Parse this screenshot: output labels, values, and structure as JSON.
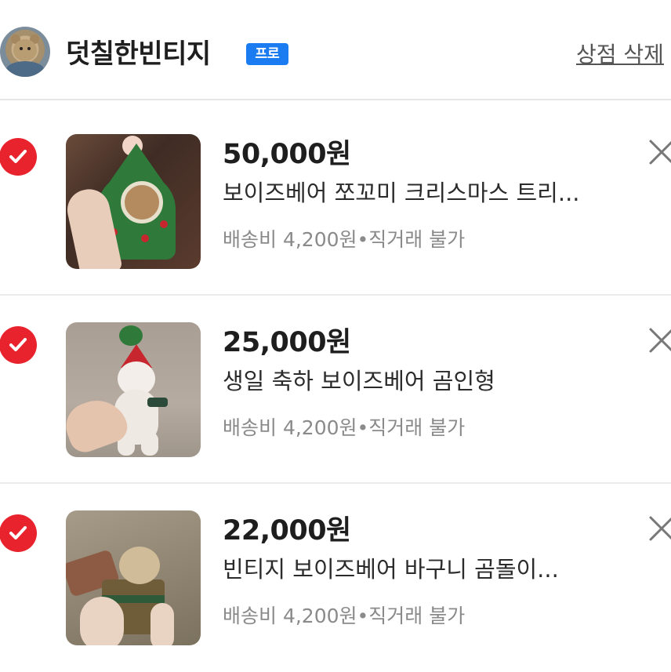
{
  "shop": {
    "name": "덧칠한빈티지",
    "badge": "프로",
    "delete_label": "상점 삭제"
  },
  "items": [
    {
      "price": "50,000원",
      "title": "보이즈베어 쪼꼬미 크리스마스 트리...",
      "shipping": "배송비 4,200원•직거래 불가",
      "checked": true
    },
    {
      "price": "25,000원",
      "title": "생일 축하 보이즈베어 곰인형",
      "shipping": "배송비 4,200원•직거래 불가",
      "checked": true
    },
    {
      "price": "22,000원",
      "title": "빈티지 보이즈베어 바구니 곰돌이...",
      "shipping": "배송비 4,200원•직거래 불가",
      "checked": true
    }
  ],
  "colors": {
    "check": "#e8232d",
    "badge": "#1b7cf2"
  }
}
